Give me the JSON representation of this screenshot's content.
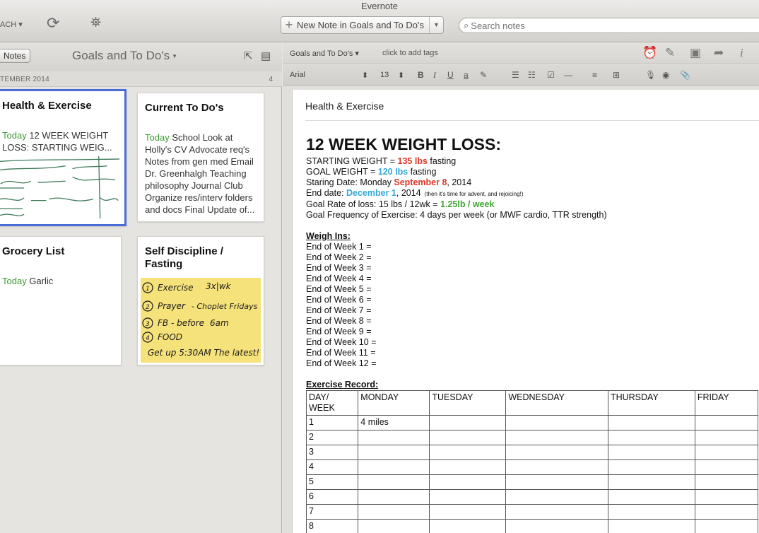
{
  "app": {
    "title": "Evernote",
    "search_scope": "ACH",
    "new_note_label": "New Note in Goals and To Do's",
    "search_placeholder": "Search notes"
  },
  "list": {
    "notes_button": "Notes",
    "notebook_title": "Goals and To Do's",
    "month": "TEMBER 2014",
    "count": "4",
    "cards": [
      {
        "title": "Health & Exercise",
        "today": "Today",
        "snippet": " 12 WEEK WEIGHT LOSS: STARTING WEIG..."
      },
      {
        "title": "Current To Do's",
        "today": "Today",
        "snippet": " School Look at Holly's CV Advocate req's Notes from gen med Email Dr. Greenhalgh Teaching philosophy Journal Club Organize res/interv folders and docs Final Update of..."
      },
      {
        "title": "Grocery List",
        "today": "Today",
        "snippet": " Garlic"
      },
      {
        "title": "Self Discipline / Fasting",
        "handwriting": [
          "Exercise 3x/wk",
          "Prayer - Chaplet Fridays",
          "FB - before 6am",
          "FOOD",
          "Get up 5:30AM The latest!"
        ]
      }
    ]
  },
  "editor": {
    "notebook": "Goals and To Do's",
    "tags_placeholder": "click to add tags",
    "font": "Arial",
    "font_size": "13",
    "note_title": "Health & Exercise",
    "heading": "12 WEEK WEIGHT LOSS:",
    "lines": {
      "start_a": "STARTING WEIGHT = ",
      "start_b": "135 lbs",
      "start_c": " fasting",
      "goal_a": "GOAL WEIGHT = ",
      "goal_b": "120 lbs",
      "goal_c": " fasting",
      "sd_a": "Staring Date: Monday ",
      "sd_b": "September 8",
      "sd_c": ", 2014",
      "ed_a": "End date: ",
      "ed_b": "December 1",
      "ed_c": ", 2014",
      "ed_note": "(then it's time for advent, and rejoicing!)",
      "rate_a": "Goal Rate of loss: 15 lbs / 12wk = ",
      "rate_b": "1.25lb / week",
      "freq": "Goal Frequency of Exercise: 4 days per week (or MWF cardio, TTR strength)"
    },
    "weigh_ins_label": "Weigh Ins:",
    "weigh_ins": [
      "End of Week 1 =",
      "End of Week 2 =",
      "End of Week 3 =",
      "End of Week 4 =",
      "End of Week 5 =",
      "End of Week 6 =",
      "End of Week 7 =",
      "End of Week 8 =",
      "End of Week 9 =",
      "End of Week 10 =",
      "End of Week 11 =",
      "End of Week 12 ="
    ],
    "exercise_label": "Exercise Record:",
    "table_headers": [
      "DAY/ WEEK",
      "MONDAY",
      "TUESDAY",
      "WEDNESDAY",
      "THURSDAY",
      "FRIDAY"
    ],
    "table_rows": [
      [
        "1",
        "4 miles",
        "",
        "",
        "",
        ""
      ],
      [
        "2",
        "",
        "",
        "",
        "",
        ""
      ],
      [
        "3",
        "",
        "",
        "",
        "",
        ""
      ],
      [
        "4",
        "",
        "",
        "",
        "",
        ""
      ],
      [
        "5",
        "",
        "",
        "",
        "",
        ""
      ],
      [
        "6",
        "",
        "",
        "",
        "",
        ""
      ],
      [
        "7",
        "",
        "",
        "",
        "",
        ""
      ],
      [
        "8",
        "",
        "",
        "",
        "",
        ""
      ]
    ]
  }
}
